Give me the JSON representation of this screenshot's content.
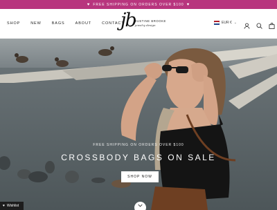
{
  "announcement": {
    "text": "FREE SHIPPING ON ORDERS OVER $100",
    "icon": "heart-icon",
    "background": "#b8357e"
  },
  "nav": {
    "items": [
      "SHOP",
      "NEW",
      "BAGS",
      "ABOUT",
      "CONTACT"
    ]
  },
  "logo": {
    "monogram": "jb",
    "name": "JUSTINE BROOKE",
    "tagline": "jewelry design"
  },
  "currency": {
    "code": "EUR €",
    "flag": "netherlands-flag"
  },
  "header_icons": [
    "account-icon",
    "search-icon",
    "cart-icon"
  ],
  "hero": {
    "tagline": "FREE SHIPPING ON ORDERS OVER $100",
    "headline": "CROSSBODY BAGS ON SALE",
    "cta": "SHOP NOW"
  },
  "wishlist": {
    "label": "Wishlist",
    "icon": "heart-icon"
  }
}
